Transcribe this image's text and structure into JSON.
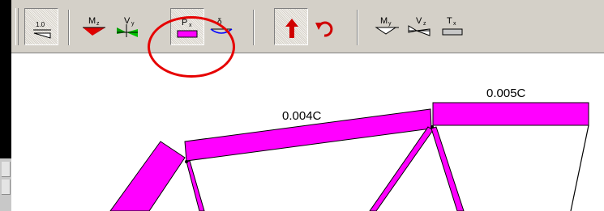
{
  "toolbar": {
    "buttons": [
      {
        "name": "unit-scale-button",
        "icon": "unit-scale-icon",
        "text": "1.0",
        "sub": "",
        "pressed": true
      },
      {
        "name": "moment-mz-button",
        "icon": "moment-diagram-icon",
        "text": "M",
        "sub": "z",
        "pressed": false
      },
      {
        "name": "shear-vy-button",
        "icon": "shear-diagram-icon",
        "text": "V",
        "sub": "y",
        "pressed": false
      },
      {
        "name": "axial-px-button",
        "icon": "axial-force-icon",
        "text": "P",
        "sub": "x",
        "pressed": true
      },
      {
        "name": "deflection-button",
        "icon": "deflection-icon",
        "text": "δ",
        "sub": "",
        "pressed": false
      },
      {
        "name": "reactions-button",
        "icon": "arrow-up-icon",
        "text": "",
        "sub": "",
        "pressed": true
      },
      {
        "name": "reaction-moment-button",
        "icon": "rotate-arrow-icon",
        "text": "",
        "sub": "",
        "pressed": false
      },
      {
        "name": "moment-my-button",
        "icon": "moment-my-icon",
        "text": "M",
        "sub": "y",
        "pressed": false
      },
      {
        "name": "shear-vz-button",
        "icon": "shear-vz-icon",
        "text": "V",
        "sub": "z",
        "pressed": false
      },
      {
        "name": "torsion-tx-button",
        "icon": "torsion-icon",
        "text": "T",
        "sub": "x",
        "pressed": false
      }
    ]
  },
  "colors": {
    "axial": "#ff00ff",
    "toolbar": "#d4d0c8",
    "highlight": "#e60000",
    "moment": "#e00000",
    "shear": "#00b000",
    "deflection": "#0000ff"
  },
  "canvas": {
    "labels": {
      "top_chord_left": "0.004C",
      "top_chord_right": "0.005C"
    }
  }
}
